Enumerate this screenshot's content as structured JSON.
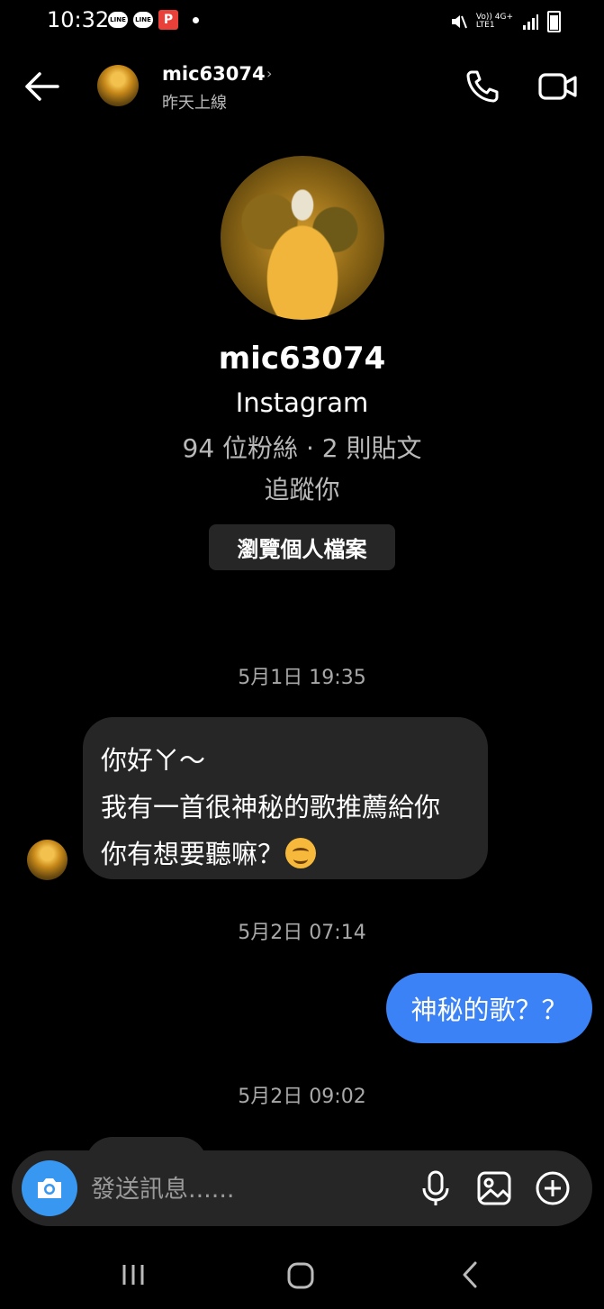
{
  "status_bar": {
    "time": "10:32",
    "line_label": "LINE",
    "flag_label": "P",
    "network_top": "Vo)) 4G+",
    "network_bottom": "LTE1"
  },
  "header": {
    "username": "mic63074",
    "chevron": "›",
    "last_seen": "昨天上線"
  },
  "profile": {
    "name": "mic63074",
    "platform": "Instagram",
    "stats": "94 位粉絲 · 2 則貼文",
    "relationship": "追蹤你",
    "view_profile_label": "瀏覽個人檔案"
  },
  "conversation": {
    "timestamps": [
      "5月1日 19:35",
      "5月2日 07:14",
      "5月2日 09:02"
    ],
    "incoming": {
      "lines": [
        "你好ㄚ～",
        "我有一首很神秘的歌推薦給你",
        "你有想要聽嘛？"
      ],
      "emoji": "smiling-face"
    },
    "outgoing": {
      "text": "神秘的歌？？"
    }
  },
  "composer": {
    "placeholder": "發送訊息......"
  },
  "colors": {
    "background": "#000000",
    "bubble_incoming": "#262626",
    "bubble_outgoing": "#3b82f6",
    "camera_button": "#3897f0"
  },
  "icons": {
    "back": "back-arrow-icon",
    "call": "phone-icon",
    "video": "video-camera-icon",
    "camera": "camera-icon",
    "mic": "microphone-icon",
    "gallery": "image-icon",
    "add": "plus-icon"
  }
}
